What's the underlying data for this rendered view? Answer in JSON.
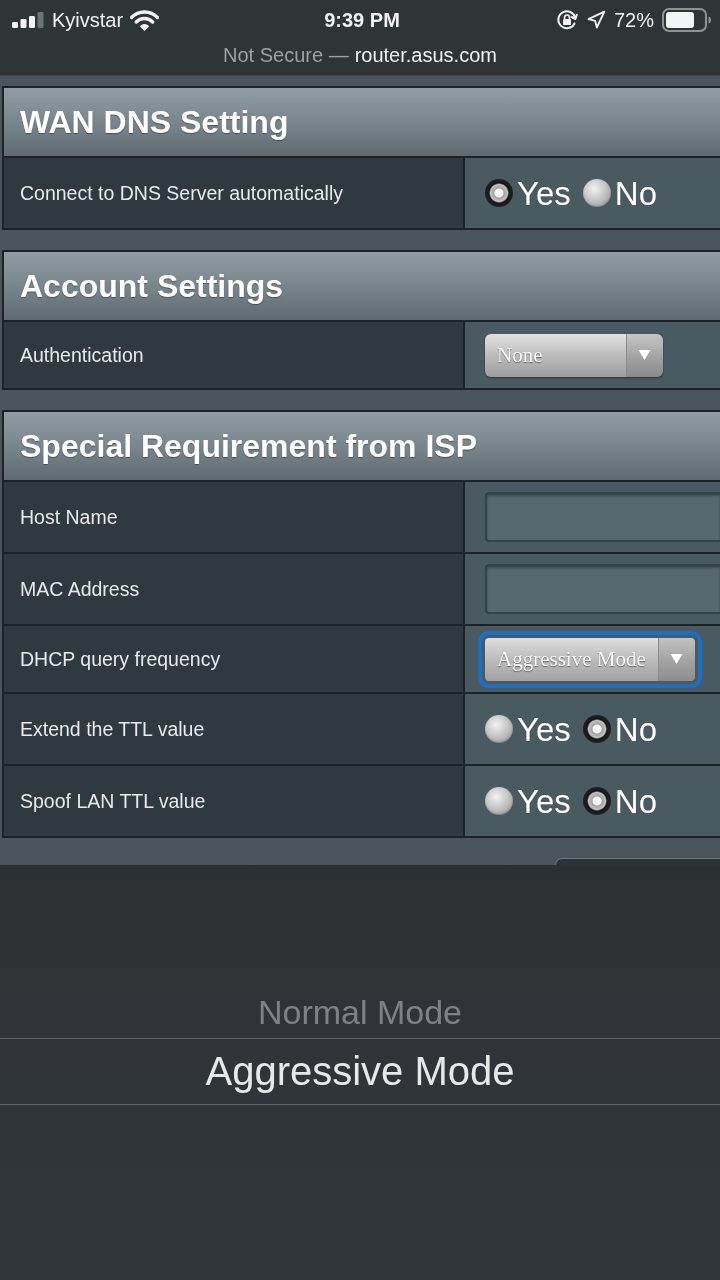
{
  "status_bar": {
    "carrier": "Kyivstar",
    "time": "9:39 PM",
    "battery": "72%"
  },
  "address_bar": {
    "security": "Not Secure —",
    "domain": "router.asus.com"
  },
  "sections": [
    {
      "title": "WAN DNS Setting",
      "rows": [
        {
          "label": "Connect to DNS Server automatically",
          "kind": "radio",
          "options": [
            {
              "label": "Yes",
              "selected": true
            },
            {
              "label": "No",
              "selected": false
            }
          ]
        }
      ]
    },
    {
      "title": "Account Settings",
      "rows": [
        {
          "label": "Authentication",
          "kind": "select",
          "value": "None",
          "focused": false
        }
      ]
    },
    {
      "title": "Special Requirement from ISP",
      "rows": [
        {
          "label": "Host Name",
          "kind": "text"
        },
        {
          "label": "MAC Address",
          "kind": "text"
        },
        {
          "label": "DHCP query frequency",
          "kind": "select",
          "value": "Aggressive Mode",
          "focused": true
        },
        {
          "label": "Extend the TTL value",
          "kind": "radio",
          "options": [
            {
              "label": "Yes",
              "selected": false
            },
            {
              "label": "No",
              "selected": true
            }
          ]
        },
        {
          "label": "Spoof LAN TTL value",
          "kind": "radio",
          "options": [
            {
              "label": "Yes",
              "selected": false
            },
            {
              "label": "No",
              "selected": true
            }
          ]
        }
      ]
    }
  ],
  "picker": {
    "options": [
      {
        "label": "Normal Mode",
        "selected": false
      },
      {
        "label": "Aggressive Mode",
        "selected": true
      }
    ]
  }
}
